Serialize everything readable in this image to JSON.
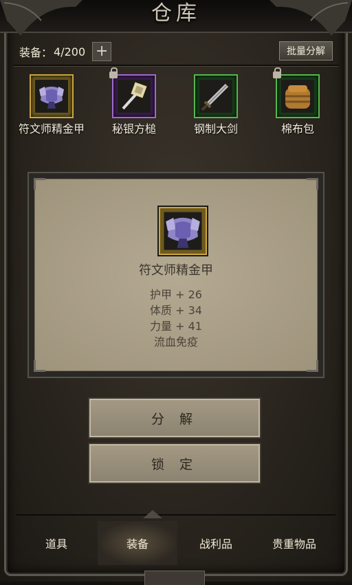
{
  "header": {
    "title": "仓库"
  },
  "capacity": {
    "label": "装备：",
    "value": "4/200",
    "add_icon": "plus-icon"
  },
  "batch_button": {
    "label": "批量分解"
  },
  "items": [
    {
      "name": "符文师精金甲",
      "rarity_color": "#c9a640",
      "icon": "armor-icon",
      "locked": false
    },
    {
      "name": "秘银方槌",
      "rarity_color": "#a06ad0",
      "icon": "hammer-icon",
      "locked": true
    },
    {
      "name": "钢制大剑",
      "rarity_color": "#58b54f",
      "icon": "sword-icon",
      "locked": false
    },
    {
      "name": "棉布包",
      "rarity_color": "#58b54f",
      "icon": "bag-icon",
      "locked": true
    }
  ],
  "detail": {
    "name": "符文师精金甲",
    "icon": "armor-icon",
    "stats": [
      "护甲 + 26",
      "体质 + 34",
      "力量 + 41",
      "流血免疫"
    ]
  },
  "actions": {
    "decompose": "分 解",
    "lock": "锁 定"
  },
  "tabs": [
    {
      "label": "道具",
      "active": false
    },
    {
      "label": "装备",
      "active": true
    },
    {
      "label": "战利品",
      "active": false
    },
    {
      "label": "贵重物品",
      "active": false
    }
  ]
}
